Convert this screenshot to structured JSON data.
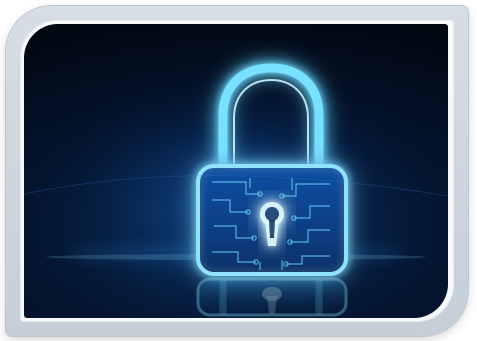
{
  "image": {
    "subject": "padlock-icon",
    "colors": {
      "frame": "#cfd6de",
      "frame_inner": "#f6f8fa",
      "background_dark": "#020914",
      "background_mid": "#0a2a55",
      "glow": "#3fb2ff",
      "neon": "#8fe3ff"
    }
  }
}
